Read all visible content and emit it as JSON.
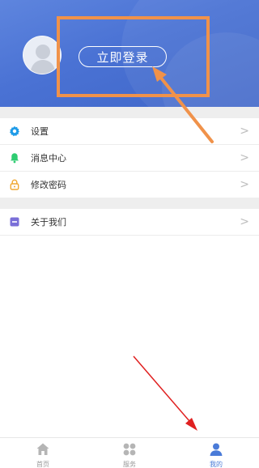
{
  "header": {
    "login_label": "立即登录"
  },
  "menu": {
    "items": [
      {
        "label": "设置",
        "icon": "gear-icon",
        "color": "#1e9be8"
      },
      {
        "label": "消息中心",
        "icon": "bell-icon",
        "color": "#2ecc71"
      },
      {
        "label": "修改密码",
        "icon": "lock-icon",
        "color": "#f0a830"
      }
    ],
    "about": {
      "label": "关于我们",
      "icon": "about-icon",
      "color": "#7a6fd8"
    },
    "chevron": ">"
  },
  "tabbar": {
    "tabs": [
      {
        "label": "首页",
        "icon": "home-icon",
        "active": false
      },
      {
        "label": "服务",
        "icon": "grid-icon",
        "active": false
      },
      {
        "label": "我的",
        "icon": "user-icon",
        "active": true
      }
    ],
    "active_color": "#4a7bd8"
  },
  "colors": {
    "header_blue": "#4a72d4",
    "annotation_orange": "#f0924a",
    "annotation_red": "#e02020"
  }
}
